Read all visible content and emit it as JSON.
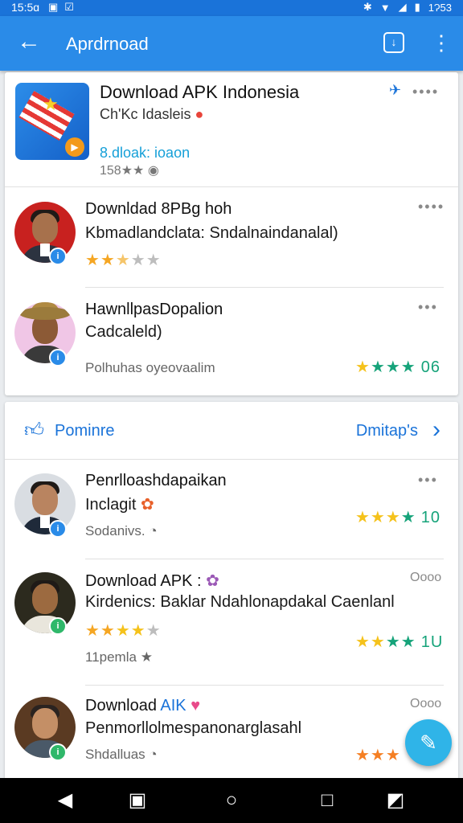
{
  "status_bar": {
    "time": "15:5ɑ",
    "clock_right": "1Ɂ53"
  },
  "app_bar": {
    "title": "Aprdrnoad"
  },
  "featured": {
    "title": "Download APK Indonesia",
    "subtitle": "Ch'Kc Idasleis",
    "link": "8.dloak: ioaon",
    "meta": "158★★"
  },
  "list1": [
    {
      "title": "Downldad 8PBg hoh",
      "subtitle": "Kbmadlandclata: Sndalnaindanalal)",
      "stars": "★★★★★",
      "meta": "",
      "score": ""
    },
    {
      "title": "HawnllpasDopalion",
      "subtitle": "Cadcaleld)",
      "stars": "★★★★",
      "meta": "Polhuhas oyeovaalim",
      "score": "06"
    }
  ],
  "section": {
    "title": "Pominre",
    "more": "Dmitap's"
  },
  "list2": [
    {
      "title": "Penrlloashdapaikan",
      "subtitle": "Inclagit",
      "meta": "Sodanivs.",
      "stars": "★★★★",
      "score": "10"
    },
    {
      "title": "Download APK :",
      "subtitle": "Kirdenics: Baklar Ndahlonapdakal Caenlanl",
      "meta": "11pemla",
      "stars": "★★★★",
      "score": "1U",
      "top_stars": "★★★★★",
      "dots": "Oooo"
    },
    {
      "title": "Download",
      "title_accent": "AIK",
      "subtitle": "Penmorllolmespanonarglasahl",
      "meta": "Shdalluas",
      "stars": "★★★",
      "score": "",
      "dots": "Oooo"
    }
  ],
  "colors": {
    "appbar": "#2a8be8",
    "accent": "#1a73d9",
    "fab": "#2fb4e8",
    "star": "#f5a623",
    "green_star": "#16a37a"
  },
  "icons": [
    "back-arrow-icon",
    "download-icon",
    "more-vert-icon",
    "like-icon",
    "chevron-right-icon",
    "edit-icon",
    "nav-back-icon",
    "nav-home-icon",
    "nav-recents-icon"
  ]
}
